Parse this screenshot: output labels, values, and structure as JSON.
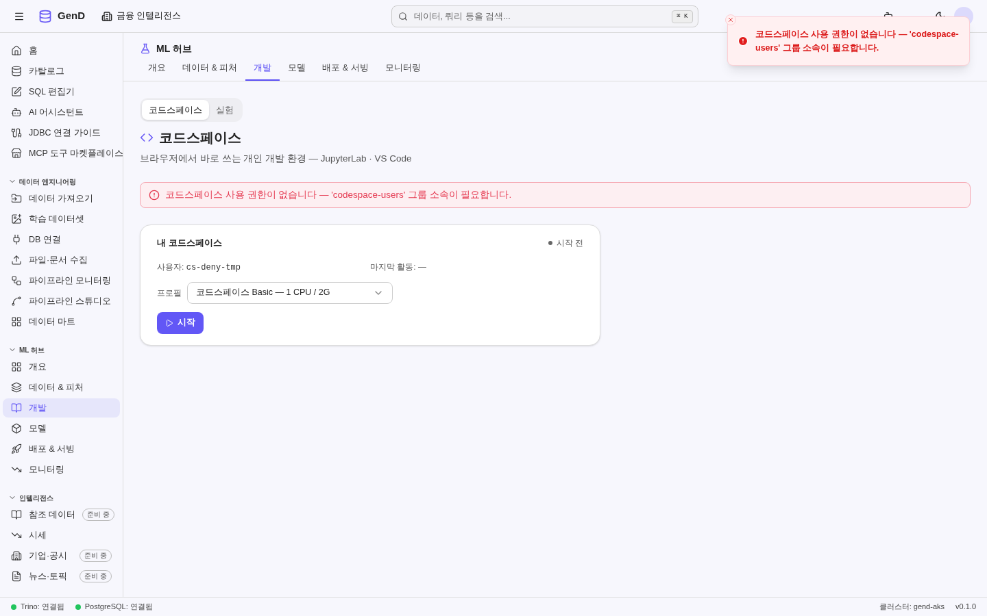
{
  "header": {
    "brand": "GenD",
    "workspace": "금융 인텔리전스",
    "search": {
      "placeholder": "데이터, 쿼리 등을 검색...",
      "shortcut": "⌘ K"
    }
  },
  "sidebar": {
    "top_items": [
      {
        "label": "홈",
        "selected": false
      },
      {
        "label": "카탈로그",
        "selected": false
      },
      {
        "label": "SQL 편집기",
        "selected": false
      },
      {
        "label": "AI 어시스턴트",
        "selected": false
      },
      {
        "label": "JDBC 연결 가이드",
        "selected": false
      },
      {
        "label": "MCP 도구 마켓플레이스",
        "selected": false
      }
    ],
    "sections": [
      {
        "title": "데이터 엔지니어링",
        "expanded": true,
        "items": [
          {
            "label": "데이터 가져오기",
            "selected": false
          },
          {
            "label": "학습 데이터셋",
            "selected": false
          },
          {
            "label": "DB 연결",
            "selected": false
          },
          {
            "label": "파일·문서 수집",
            "selected": false
          },
          {
            "label": "파이프라인 모니터링",
            "selected": false
          },
          {
            "label": "파이프라인 스튜디오",
            "selected": false
          },
          {
            "label": "데이터 마트",
            "selected": false
          }
        ]
      },
      {
        "title": "ML 허브",
        "expanded": true,
        "items": [
          {
            "label": "개요",
            "selected": false
          },
          {
            "label": "데이터 & 피처",
            "selected": false
          },
          {
            "label": "개발",
            "selected": true
          },
          {
            "label": "모델",
            "selected": false
          },
          {
            "label": "배포 & 서빙",
            "selected": false
          },
          {
            "label": "모니터링",
            "selected": false
          }
        ]
      },
      {
        "title": "인텔리전스",
        "expanded": true,
        "items": [
          {
            "label": "참조 데이터",
            "selected": false,
            "badge": "준비 중"
          },
          {
            "label": "시세",
            "selected": false
          },
          {
            "label": "기업·공시",
            "selected": false,
            "badge": "준비 중"
          },
          {
            "label": "뉴스·토픽",
            "selected": false,
            "badge": "준비 중"
          }
        ]
      }
    ]
  },
  "page": {
    "title": "ML 허브",
    "tabs": [
      {
        "label": "개요",
        "selected": false
      },
      {
        "label": "데이터 & 피처",
        "selected": false
      },
      {
        "label": "개발",
        "selected": true
      },
      {
        "label": "모델",
        "selected": false
      },
      {
        "label": "배포 & 서빙",
        "selected": false
      },
      {
        "label": "모니터링",
        "selected": false
      }
    ],
    "segments": [
      {
        "label": "코드스페이스",
        "selected": true
      },
      {
        "label": "실험",
        "selected": false
      }
    ],
    "heading": "코드스페이스",
    "subtitle": "브라우저에서 바로 쓰는 개인 개발 환경 — JupyterLab · VS Code",
    "alert": "코드스페이스 사용 권한이 없습니다 — 'codespace-users' 그룹 소속이 필요합니다.",
    "card": {
      "title": "내 코드스페이스",
      "status": "시작 전",
      "user_label": "사용자:",
      "user": "cs-deny-tmp",
      "activity_label": "마지막 활동:",
      "activity": "—",
      "profile_label": "프로필",
      "profile": "코드스페이스 Basic — 1 CPU / 2G",
      "start": "시작"
    }
  },
  "toast": {
    "message": "코드스페이스 사용 권한이 없습니다 — 'codespace-users' 그룹 소속이 필요합니다."
  },
  "status_bar": {
    "connections": [
      {
        "label": "Trino: 연결됨",
        "color": "#22c55e"
      },
      {
        "label": "PostgreSQL: 연결됨",
        "color": "#22c55e"
      }
    ],
    "cluster": "클러스터: gend-aks",
    "version": "v0.1.0"
  }
}
